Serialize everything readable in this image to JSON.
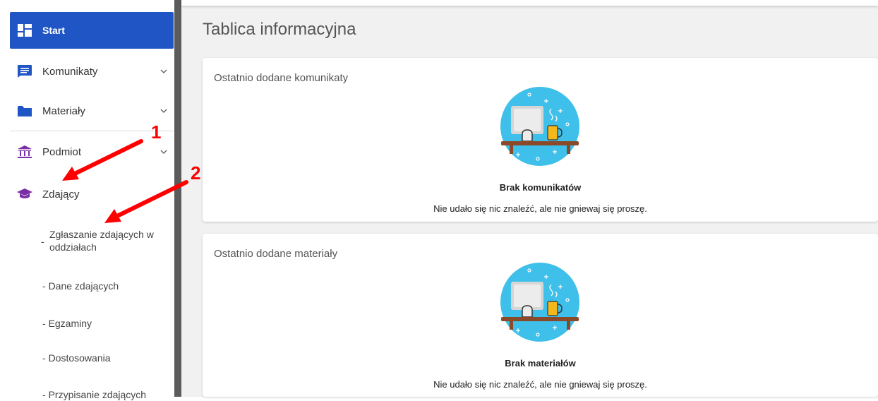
{
  "sidebar": {
    "start_label": "Start",
    "items": [
      {
        "label": "Komunikaty",
        "icon": "message-icon"
      },
      {
        "label": "Materiały",
        "icon": "folder-icon"
      },
      {
        "label": "Podmiot",
        "icon": "institution-icon"
      },
      {
        "label": "Zdający",
        "icon": "graduation-cap-icon"
      }
    ],
    "sub_items": [
      {
        "dash": "-",
        "line1": "Zgłaszanie zdających w",
        "line2": "oddziałach"
      },
      {
        "dash": "-",
        "label": "Dane zdających"
      },
      {
        "dash": "-",
        "label": "Egzaminy"
      },
      {
        "dash": "-",
        "label": "Dostosowania"
      },
      {
        "dash": "-",
        "label": "Przypisanie zdających"
      }
    ]
  },
  "main": {
    "title": "Tablica informacyjna",
    "cards": [
      {
        "title": "Ostatnio dodane komunikaty",
        "empty_title": "Brak komunikatów",
        "empty_text": "Nie udało się nic znaleźć, ale nie gniewaj się proszę."
      },
      {
        "title": "Ostatnio dodane materiały",
        "empty_title": "Brak materiałów",
        "empty_text": "Nie udało się nic znaleźć, ale nie gniewaj się proszę."
      }
    ]
  },
  "annotations": [
    "1",
    "2"
  ],
  "colors": {
    "accent": "#1f55c4",
    "annotation": "#ff0000",
    "illustration_bg": "#3ec0ea",
    "purple_icon": "#7b2fa6"
  }
}
